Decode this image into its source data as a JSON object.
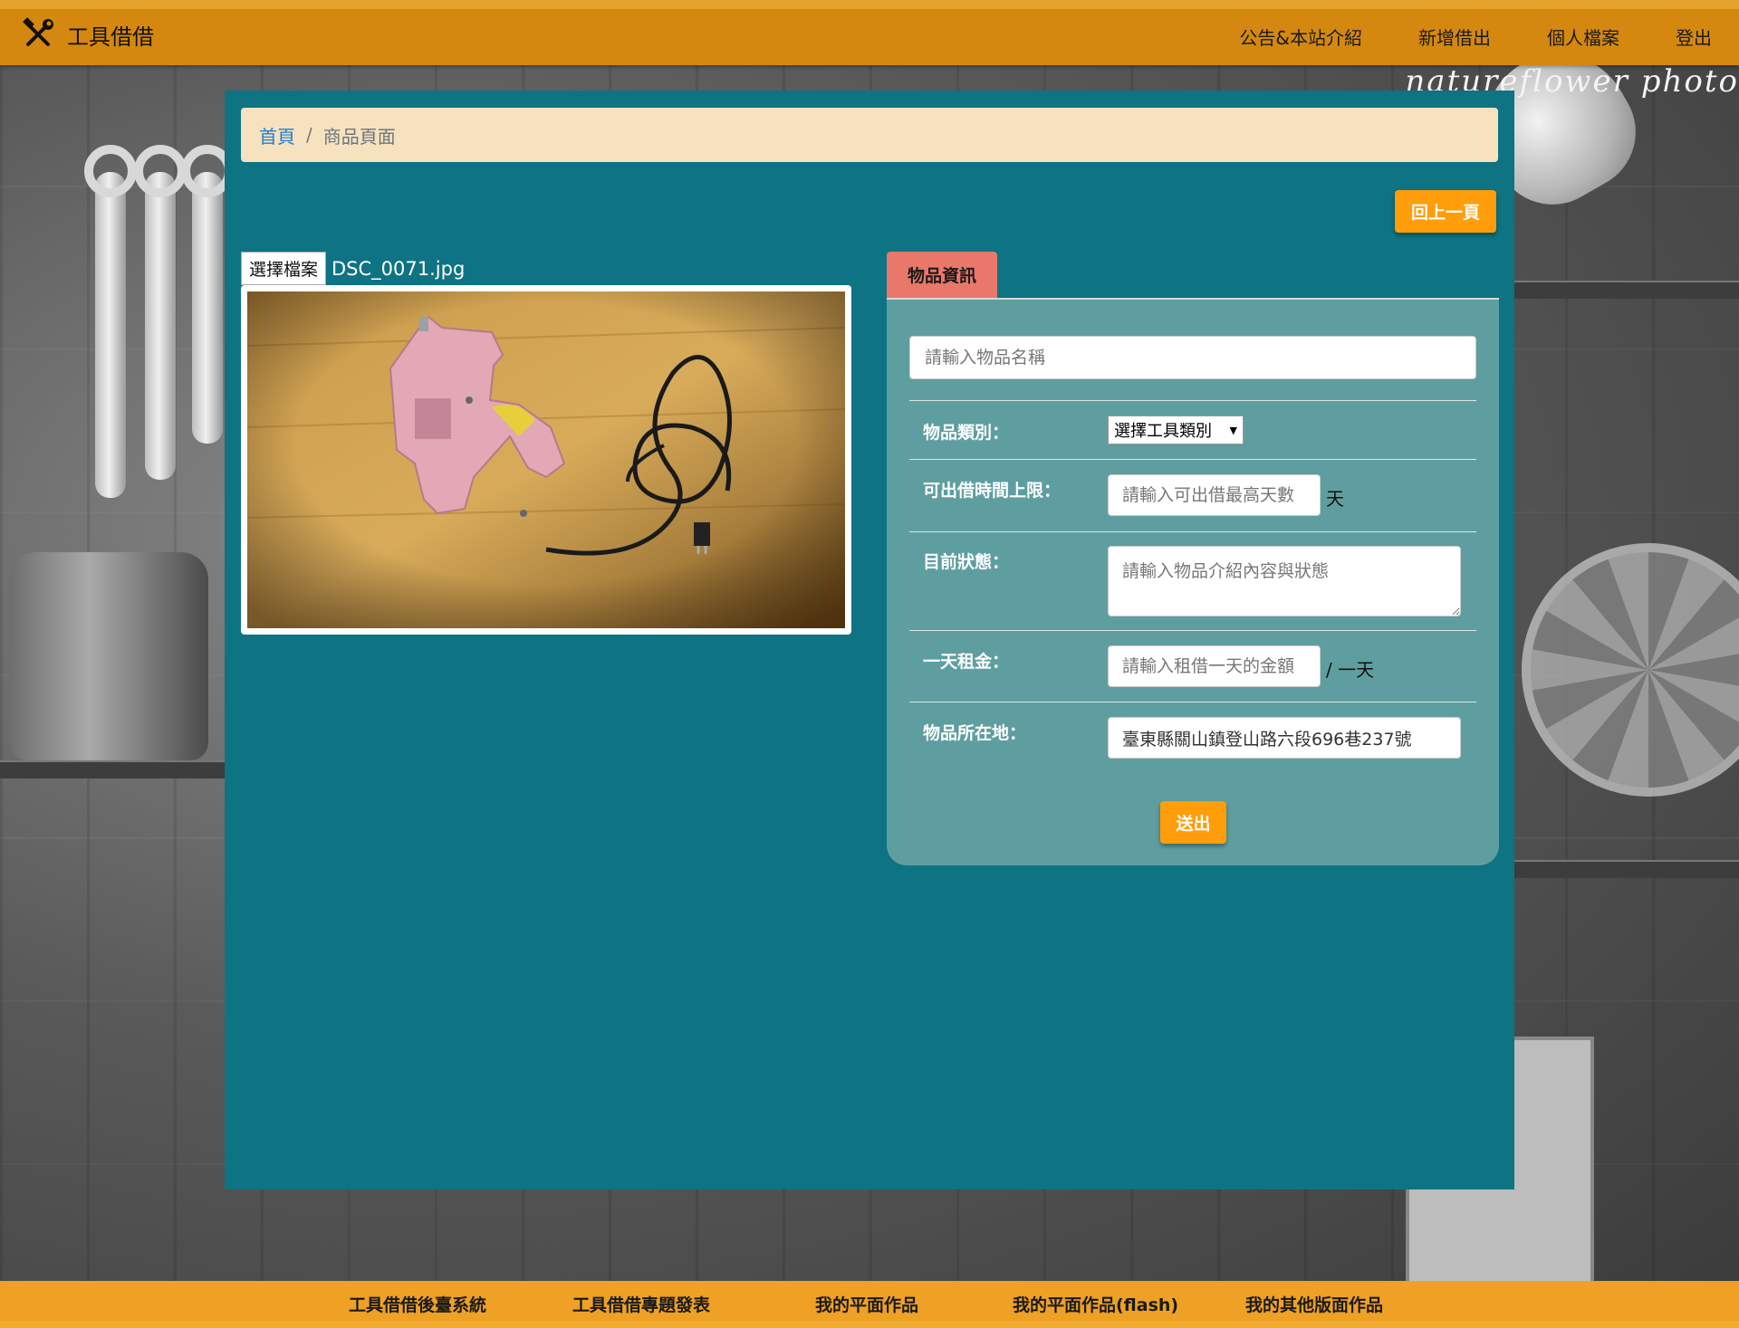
{
  "app": {
    "brand_title": "工具借借",
    "brand_icon": "tools-icon"
  },
  "nav": {
    "items": [
      "公告&本站介紹",
      "新增借出",
      "個人檔案",
      "登出"
    ]
  },
  "background": {
    "watermark": "natureflower photo"
  },
  "breadcrumb": {
    "home": "首頁",
    "separator": "/",
    "current": "商品頁面"
  },
  "back_button": "回上一頁",
  "upload": {
    "choose_label": "選擇檔案",
    "file_name": "DSC_0071.jpg",
    "image_subject": "glue-gun-photo"
  },
  "item_form": {
    "tab_label": "物品資訊",
    "name_placeholder": "請輸入物品名稱",
    "category_label": "物品類別：",
    "category_selected": "選擇工具類別",
    "max_days_label": "可出借時間上限：",
    "max_days_placeholder": "請輸入可出借最高天數",
    "max_days_unit": "天",
    "status_label": "目前狀態：",
    "status_placeholder": "請輸入物品介紹內容與狀態",
    "rent_label": "一天租金：",
    "rent_placeholder": "請輸入租借一天的金額",
    "rent_unit": "/ 一天",
    "location_label": "物品所在地：",
    "location_value": "臺東縣關山鎮登山路六段696巷237號",
    "submit": "送出"
  },
  "footer": {
    "links": [
      "工具借借後臺系統",
      "工具借借專題發表",
      "我的平面作品",
      "我的平面作品(flash)",
      "我的其他版面作品"
    ]
  },
  "colors": {
    "navbar": "#d4880f",
    "panel": "#0e7383",
    "card": "#5f9ea0",
    "tab": "#e9786a",
    "button": "#ff9d0a",
    "breadcrumb_bg": "#f7e2bf",
    "footer": "#eea125"
  }
}
